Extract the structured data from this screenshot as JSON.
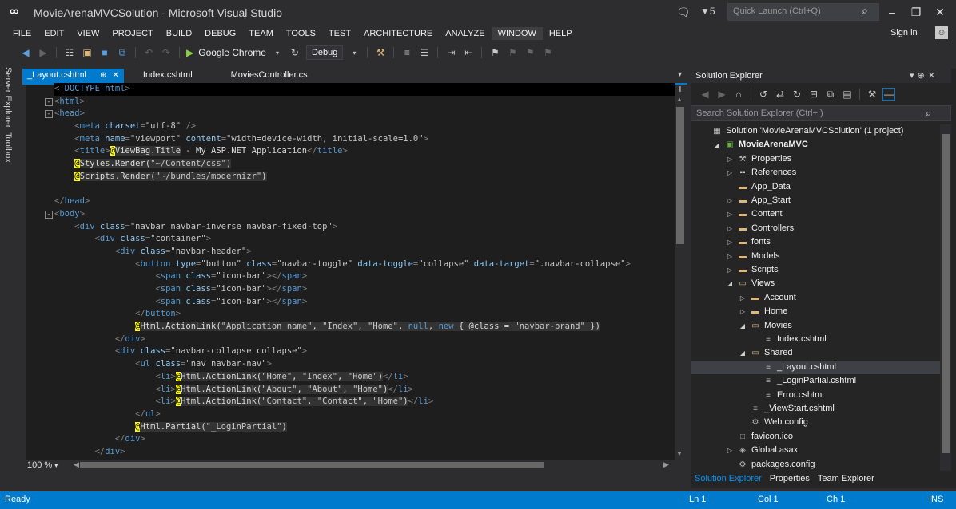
{
  "window": {
    "title": "MovieArenaMVCSolution - Microsoft Visual Studio",
    "quick_launch_placeholder": "Quick Launch (Ctrl+Q)",
    "filter_badge": "5"
  },
  "menu": {
    "items": [
      "FILE",
      "EDIT",
      "VIEW",
      "PROJECT",
      "BUILD",
      "DEBUG",
      "TEAM",
      "TOOLS",
      "TEST",
      "ARCHITECTURE",
      "ANALYZE",
      "WINDOW",
      "HELP"
    ],
    "active": "WINDOW",
    "sign_in": "Sign in"
  },
  "toolbar": {
    "browser": "Google Chrome",
    "configuration": "Debug"
  },
  "left_strip": {
    "server_explorer": "Server Explorer",
    "toolbox": "Toolbox"
  },
  "editor": {
    "tabs": [
      "_Layout.cshtml",
      "Index.cshtml",
      "MoviesController.cs"
    ],
    "active_tab": "_Layout.cshtml",
    "zoom": "100 %",
    "code_lines": [
      "<!DOCTYPE html>",
      "<html>",
      "<head>",
      "    <meta charset=\"utf-8\" />",
      "    <meta name=\"viewport\" content=\"width=device-width, initial-scale=1.0\">",
      "    <title>@ViewBag.Title - My ASP.NET Application</title>",
      "    @Styles.Render(\"~/Content/css\")",
      "    @Scripts.Render(\"~/bundles/modernizr\")",
      "",
      "</head>",
      "<body>",
      "    <div class=\"navbar navbar-inverse navbar-fixed-top\">",
      "        <div class=\"container\">",
      "            <div class=\"navbar-header\">",
      "                <button type=\"button\" class=\"navbar-toggle\" data-toggle=\"collapse\" data-target=\".navbar-collapse\">",
      "                    <span class=\"icon-bar\"></span>",
      "                    <span class=\"icon-bar\"></span>",
      "                    <span class=\"icon-bar\"></span>",
      "                </button>",
      "                @Html.ActionLink(\"Application name\", \"Index\", \"Home\", null, new { @class = \"navbar-brand\" })",
      "            </div>",
      "            <div class=\"navbar-collapse collapse\">",
      "                <ul class=\"nav navbar-nav\">",
      "                    <li>@Html.ActionLink(\"Home\", \"Index\", \"Home\")</li>",
      "                    <li>@Html.ActionLink(\"About\", \"About\", \"Home\")</li>",
      "                    <li>@Html.ActionLink(\"Contact\", \"Contact\", \"Home\")</li>",
      "                </ul>",
      "                @Html.Partial(\"_LoginPartial\")",
      "            </div>",
      "        </div>"
    ]
  },
  "solution_explorer": {
    "title": "Solution Explorer",
    "search_placeholder": "Search Solution Explorer (Ctrl+;)",
    "nodes": [
      {
        "label": "Solution 'MovieArenaMVCSolution' (1 project)",
        "icon": "solution-icon",
        "indent": 0,
        "arrow": ""
      },
      {
        "label": "MovieArenaMVC",
        "icon": "project-icon",
        "indent": 1,
        "arrow": "expanded",
        "bold": true
      },
      {
        "label": "Properties",
        "icon": "wrench-icon",
        "indent": 2,
        "arrow": "collapsed"
      },
      {
        "label": "References",
        "icon": "references-icon",
        "indent": 2,
        "arrow": "collapsed"
      },
      {
        "label": "App_Data",
        "icon": "folder-icon",
        "indent": 2,
        "arrow": ""
      },
      {
        "label": "App_Start",
        "icon": "folder-icon",
        "indent": 2,
        "arrow": "collapsed"
      },
      {
        "label": "Content",
        "icon": "folder-icon",
        "indent": 2,
        "arrow": "collapsed"
      },
      {
        "label": "Controllers",
        "icon": "folder-icon",
        "indent": 2,
        "arrow": "collapsed"
      },
      {
        "label": "fonts",
        "icon": "folder-icon",
        "indent": 2,
        "arrow": "collapsed"
      },
      {
        "label": "Models",
        "icon": "folder-icon",
        "indent": 2,
        "arrow": "collapsed"
      },
      {
        "label": "Scripts",
        "icon": "folder-icon",
        "indent": 2,
        "arrow": "collapsed"
      },
      {
        "label": "Views",
        "icon": "folder-open-icon",
        "indent": 2,
        "arrow": "expanded"
      },
      {
        "label": "Account",
        "icon": "folder-icon",
        "indent": 3,
        "arrow": "collapsed"
      },
      {
        "label": "Home",
        "icon": "folder-icon",
        "indent": 3,
        "arrow": "collapsed"
      },
      {
        "label": "Movies",
        "icon": "folder-open-icon",
        "indent": 3,
        "arrow": "expanded"
      },
      {
        "label": "Index.cshtml",
        "icon": "cshtml-file-icon",
        "indent": 4,
        "arrow": ""
      },
      {
        "label": "Shared",
        "icon": "folder-open-icon",
        "indent": 3,
        "arrow": "expanded"
      },
      {
        "label": "_Layout.cshtml",
        "icon": "cshtml-file-icon",
        "indent": 4,
        "arrow": "",
        "selected": true
      },
      {
        "label": "_LoginPartial.cshtml",
        "icon": "cshtml-file-icon",
        "indent": 4,
        "arrow": ""
      },
      {
        "label": "Error.cshtml",
        "icon": "cshtml-file-icon",
        "indent": 4,
        "arrow": ""
      },
      {
        "label": "_ViewStart.cshtml",
        "icon": "cshtml-file-icon",
        "indent": 3,
        "arrow": ""
      },
      {
        "label": "Web.config",
        "icon": "config-file-icon",
        "indent": 3,
        "arrow": ""
      },
      {
        "label": "favicon.ico",
        "icon": "ico-file-icon",
        "indent": 2,
        "arrow": ""
      },
      {
        "label": "Global.asax",
        "icon": "asax-file-icon",
        "indent": 2,
        "arrow": "collapsed"
      },
      {
        "label": "packages.config",
        "icon": "config-file-icon",
        "indent": 2,
        "arrow": ""
      }
    ],
    "bottom_tabs": [
      "Solution Explorer",
      "Properties",
      "Team Explorer"
    ],
    "active_bottom_tab": "Solution Explorer"
  },
  "status": {
    "state": "Ready",
    "line": "Ln 1",
    "col": "Col 1",
    "ch": "Ch 1",
    "mode": "INS"
  },
  "colors": {
    "accent": "#007acc",
    "background": "#2d2d30",
    "editor_bg": "#1e1e1e"
  }
}
